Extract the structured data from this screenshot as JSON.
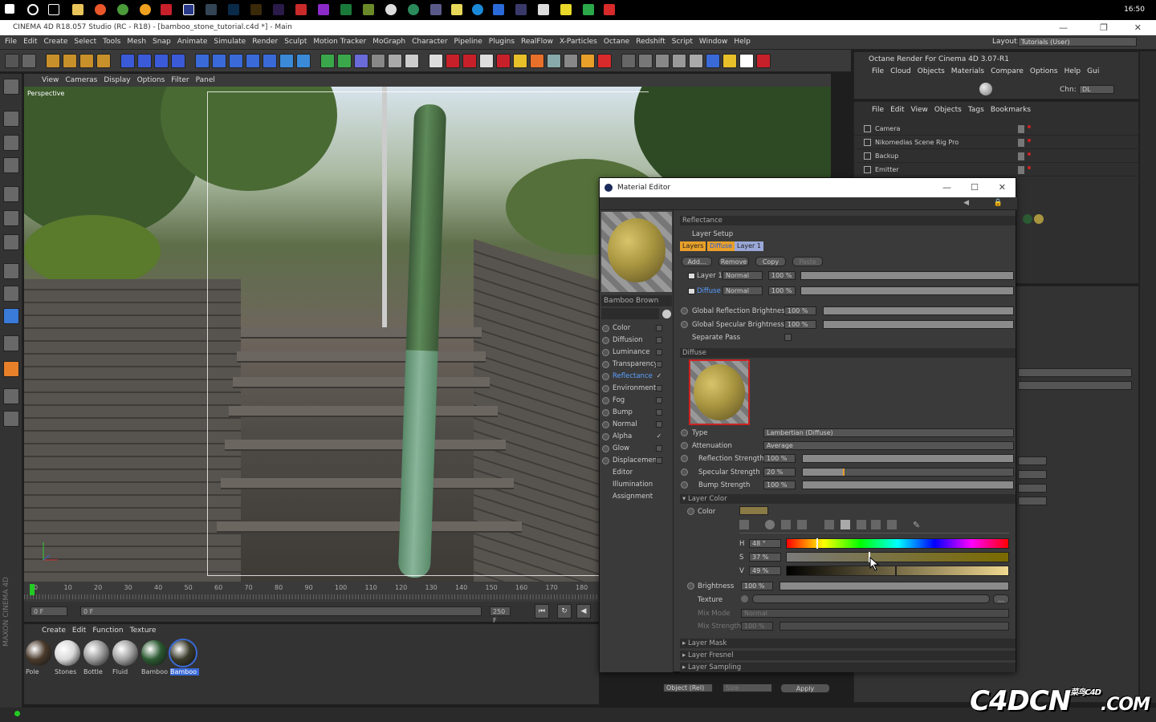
{
  "taskbar": {
    "clock": "16:50"
  },
  "window": {
    "title": "CINEMA 4D R18.057 Studio (RC - R18) - [bamboo_stone_tutorial.c4d *] - Main"
  },
  "menubar": [
    "File",
    "Edit",
    "Create",
    "Select",
    "Tools",
    "Mesh",
    "Snap",
    "Animate",
    "Simulate",
    "Render",
    "Sculpt",
    "Motion Tracker",
    "MoGraph",
    "Character",
    "Pipeline",
    "Plugins",
    "RealFlow",
    "X-Particles",
    "Octane",
    "Redshift",
    "Script",
    "Window",
    "Help"
  ],
  "layout": {
    "label": "Layout:",
    "value": "Tutorials (User)"
  },
  "viewport": {
    "menu": [
      "View",
      "Cameras",
      "Display",
      "Options",
      "Filter",
      "Panel"
    ],
    "label": "Perspective"
  },
  "timeline": {
    "ticks": [
      "0",
      "10",
      "20",
      "30",
      "40",
      "50",
      "60",
      "70",
      "80",
      "90",
      "100",
      "110",
      "120",
      "130",
      "140",
      "150",
      "160",
      "170",
      "180"
    ]
  },
  "transport": {
    "start": "0 F",
    "current": "0 F",
    "end": "250 F",
    "end2": "250 F"
  },
  "material_manager": {
    "menu": [
      "Create",
      "Edit",
      "Function",
      "Texture"
    ],
    "materials": [
      {
        "name": "Pole",
        "color": "#4a3a2c"
      },
      {
        "name": "Stones",
        "color": "#d9d9d9"
      },
      {
        "name": "Bottle",
        "color": "#9a9a9a"
      },
      {
        "name": "Fluid",
        "color": "#a0a0a0"
      },
      {
        "name": "Bamboo",
        "color": "#2c5a32"
      },
      {
        "name": "Bamboo",
        "color": "#3a3a2a",
        "selected": true
      }
    ]
  },
  "octane": {
    "title": "Octane Render For Cinema 4D 3.07-R1",
    "menu": [
      "File",
      "Cloud",
      "Objects",
      "Materials",
      "Compare",
      "Options",
      "Help",
      "Gui"
    ],
    "chn_label": "Chn:",
    "chn_value": "DL"
  },
  "object_manager": {
    "menu": [
      "File",
      "Edit",
      "View",
      "Objects",
      "Tags",
      "Bookmarks"
    ],
    "objects": [
      "Camera",
      "Nikomedias Scene Rig Pro",
      "Backup",
      "Emitter"
    ]
  },
  "material_editor": {
    "title": "Material Editor",
    "material_name": "Bamboo Brown",
    "channels": [
      {
        "name": "Color",
        "checked": false
      },
      {
        "name": "Diffusion",
        "checked": false
      },
      {
        "name": "Luminance",
        "checked": false
      },
      {
        "name": "Transparency",
        "checked": false
      },
      {
        "name": "Reflectance",
        "checked": true,
        "active": true
      },
      {
        "name": "Environment",
        "checked": false
      },
      {
        "name": "Fog",
        "checked": false
      },
      {
        "name": "Bump",
        "checked": false
      },
      {
        "name": "Normal",
        "checked": false
      },
      {
        "name": "Alpha",
        "checked": true
      },
      {
        "name": "Glow",
        "checked": false
      },
      {
        "name": "Displacement",
        "checked": false
      },
      {
        "name": "Editor",
        "checked": null
      },
      {
        "name": "Illumination",
        "checked": null
      },
      {
        "name": "Assignment",
        "checked": null
      }
    ],
    "reflectance": {
      "header": "Reflectance",
      "layer_setup": "Layer Setup",
      "tabs": [
        "Layers",
        "Diffuse",
        "Layer 1"
      ],
      "buttons": [
        "Add...",
        "Remove",
        "Copy",
        "Paste"
      ],
      "layers": [
        {
          "name": "Layer 1",
          "mode": "Normal",
          "value": "100 %"
        },
        {
          "name": "Diffuse",
          "mode": "Normal",
          "value": "100 %"
        }
      ],
      "global_reflection_label": "Global Reflection Brightness",
      "global_reflection_value": "100 %",
      "global_specular_label": "Global Specular Brightness",
      "global_specular_value": "100 %",
      "separate_pass_label": "Separate Pass"
    },
    "diffuse": {
      "header": "Diffuse",
      "type_label": "Type",
      "type_value": "Lambertian (Diffuse)",
      "attenuation_label": "Attenuation",
      "attenuation_value": "Average",
      "reflection_strength_label": "Reflection Strength",
      "reflection_strength_value": "100 %",
      "reflection_strength": 1.0,
      "specular_strength_label": "Specular Strength",
      "specular_strength_value": "20 %",
      "specular_strength": 0.2,
      "bump_strength_label": "Bump Strength",
      "bump_strength_value": "100 %",
      "bump_strength": 1.0
    },
    "layer_color": {
      "header": "Layer Color",
      "color_label": "Color",
      "swatch": "#8a7a45",
      "h_label": "H",
      "h_value": "48 °",
      "s_label": "S",
      "s_value": "37 %",
      "v_label": "V",
      "v_value": "49 %",
      "brightness_label": "Brightness",
      "brightness_value": "100 %",
      "texture_label": "Texture",
      "texture_button": "...",
      "mix_mode_label": "Mix Mode",
      "mix_mode_value": "Normal",
      "mix_strength_label": "Mix Strength",
      "mix_strength_value": "100 %"
    },
    "collapsed": [
      "Layer Mask",
      "Layer Fresnel",
      "Layer Sampling"
    ]
  },
  "coords": {
    "mode": "Object (Rel)",
    "size": "Size",
    "apply": "Apply"
  },
  "brand": {
    "logo": "C4DCN",
    "sub": "菜鸟C4D",
    "com": ".COM"
  },
  "maxon": "MAXON CINEMA 4D"
}
